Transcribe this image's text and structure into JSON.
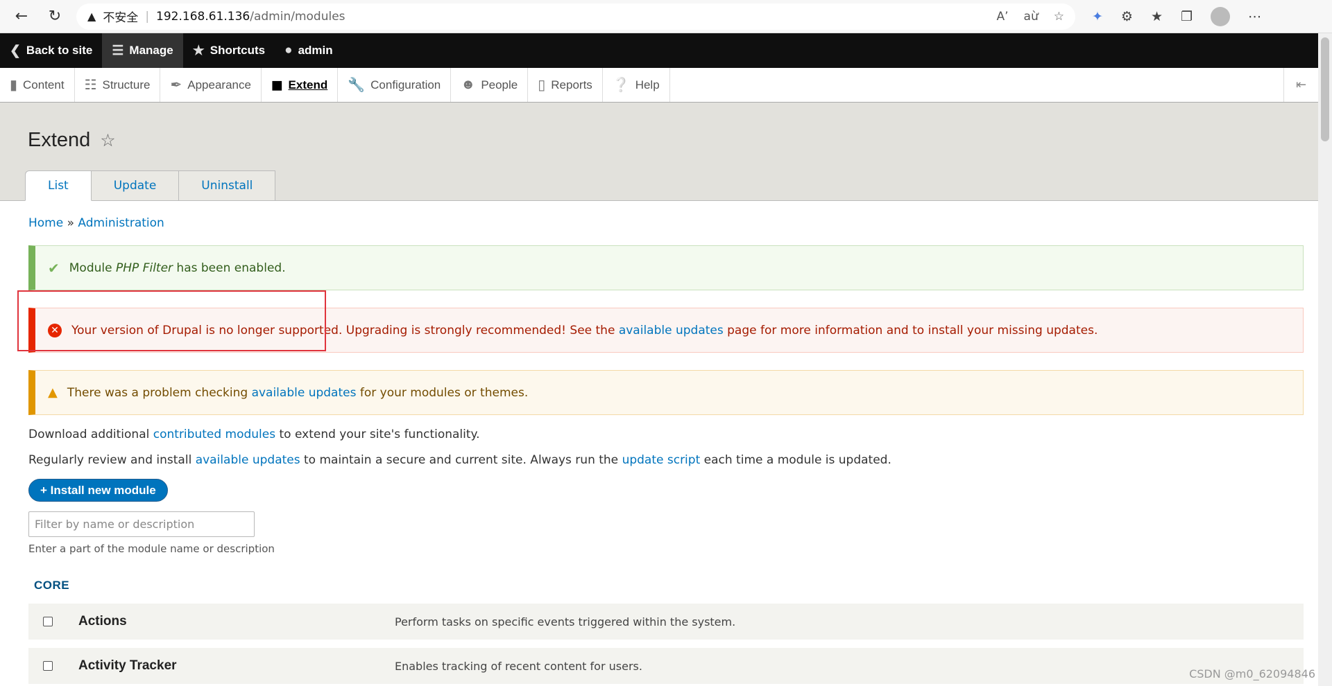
{
  "browser": {
    "security_label": "不安全",
    "url_host": "192.168.61.136",
    "url_path": "/admin/modules"
  },
  "toolbar": {
    "back_to_site": "Back to site",
    "manage": "Manage",
    "shortcuts": "Shortcuts",
    "user": "admin"
  },
  "tray": {
    "items": [
      {
        "label": "Content",
        "icon": "document-icon"
      },
      {
        "label": "Structure",
        "icon": "sitemap-icon"
      },
      {
        "label": "Appearance",
        "icon": "paintbrush-icon"
      },
      {
        "label": "Extend",
        "icon": "puzzle-icon"
      },
      {
        "label": "Configuration",
        "icon": "wrench-icon"
      },
      {
        "label": "People",
        "icon": "people-icon"
      },
      {
        "label": "Reports",
        "icon": "bar-chart-icon"
      },
      {
        "label": "Help",
        "icon": "help-icon"
      }
    ],
    "active": "Extend"
  },
  "page": {
    "title": "Extend",
    "tabs": [
      "List",
      "Update",
      "Uninstall"
    ],
    "active_tab": "List"
  },
  "breadcrumb": {
    "home": "Home",
    "sep": "»",
    "admin": "Administration"
  },
  "messages": {
    "status": {
      "before": "Module ",
      "module": "PHP Filter",
      "after": " has been enabled."
    },
    "error": {
      "before": "Your version of Drupal is no longer supported. Upgrading is strongly recommended! See the ",
      "link": "available updates",
      "after": " page for more information and to install your missing updates."
    },
    "warning": {
      "before": "There was a problem checking ",
      "link": "available updates",
      "after": " for your modules or themes."
    }
  },
  "intro": {
    "p1_before": "Download additional ",
    "p1_link": "contributed modules",
    "p1_after": " to extend your site's functionality.",
    "p2_before": "Regularly review and install ",
    "p2_link1": "available updates",
    "p2_mid": " to maintain a secure and current site. Always run the ",
    "p2_link2": "update script",
    "p2_after": " each time a module is updated."
  },
  "install_button": "+ Install new module",
  "filter": {
    "placeholder": "Filter by name or description",
    "description": "Enter a part of the module name or description"
  },
  "section": "CORE",
  "modules": [
    {
      "name": "Actions",
      "description": "Perform tasks on specific events triggered within the system."
    },
    {
      "name": "Activity Tracker",
      "description": "Enables tracking of recent content for users."
    }
  ],
  "watermark": "CSDN @m0_62094846"
}
